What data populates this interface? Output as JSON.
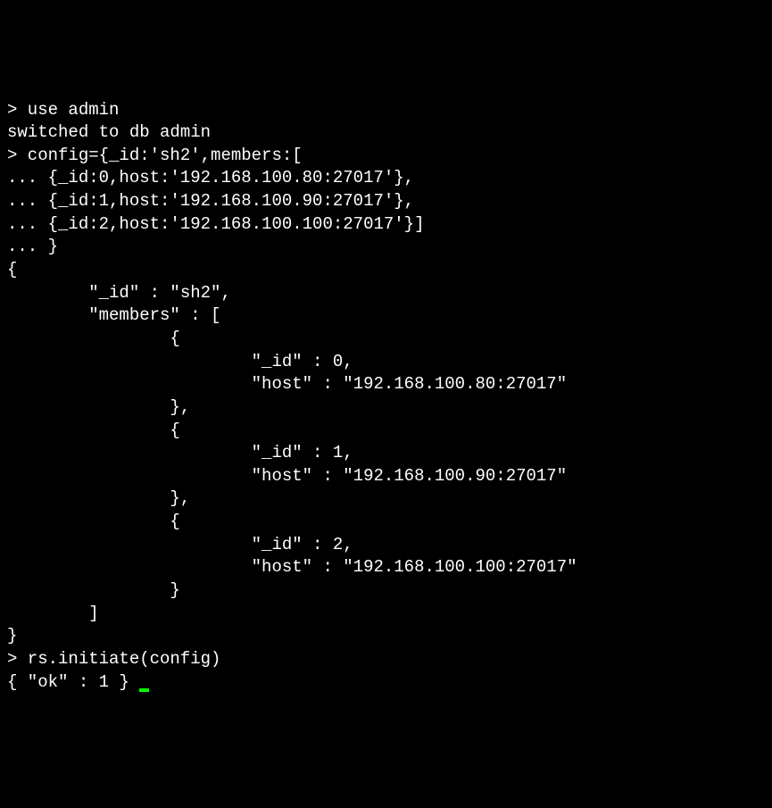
{
  "lines": {
    "l0": "> use admin",
    "l1": "switched to db admin",
    "l2": "> config={_id:'sh2',members:[",
    "l3": "... {_id:0,host:'192.168.100.80:27017'},",
    "l4": "... {_id:1,host:'192.168.100.90:27017'},",
    "l5": "... {_id:2,host:'192.168.100.100:27017'}]",
    "l6": "... }",
    "l7": "{",
    "l8": "        \"_id\" : \"sh2\",",
    "l9": "        \"members\" : [",
    "l10": "                {",
    "l11": "                        \"_id\" : 0,",
    "l12": "                        \"host\" : \"192.168.100.80:27017\"",
    "l13": "                },",
    "l14": "                {",
    "l15": "                        \"_id\" : 1,",
    "l16": "                        \"host\" : \"192.168.100.90:27017\"",
    "l17": "                },",
    "l18": "                {",
    "l19": "                        \"_id\" : 2,",
    "l20": "                        \"host\" : \"192.168.100.100:27017\"",
    "l21": "                }",
    "l22": "        ]",
    "l23": "}",
    "l24": "> rs.initiate(config)",
    "l25": "{ \"ok\" : 1 }"
  }
}
